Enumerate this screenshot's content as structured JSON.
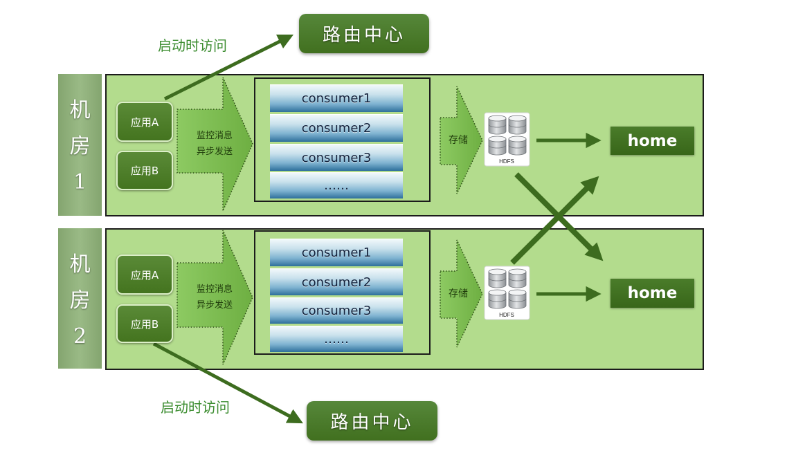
{
  "colors": {
    "dark_green": "#4a7b2b",
    "room_fill": "#b3dc8d",
    "panel_fill": "#8fae7a",
    "arrow_fill": "#7fbf52",
    "label_green": "#3c8d30",
    "consumer_top": "#f1f8fb",
    "consumer_bottom": "#2d6f9b"
  },
  "icons": {
    "hdfs": "database-cylinders-icon"
  },
  "top": {
    "access_label": "启动时访问",
    "route_center": "路由中心"
  },
  "bottom": {
    "access_label": "启动时访问",
    "route_center": "路由中心"
  },
  "rooms": [
    {
      "label": [
        "机",
        "房",
        "1"
      ],
      "apps": [
        "应用A",
        "应用B"
      ],
      "send_label": [
        "监控消息",
        "异步发送"
      ],
      "consumers": [
        "consumer1",
        "consumer2",
        "consumer3",
        "……"
      ],
      "store_label": "存储",
      "hdfs_label": "HDFS",
      "home": "home"
    },
    {
      "label": [
        "机",
        "房",
        "2"
      ],
      "apps": [
        "应用A",
        "应用B"
      ],
      "send_label": [
        "监控消息",
        "异步发送"
      ],
      "consumers": [
        "consumer1",
        "consumer2",
        "consumer3",
        "……"
      ],
      "store_label": "存储",
      "hdfs_label": "HDFS",
      "home": "home"
    }
  ]
}
